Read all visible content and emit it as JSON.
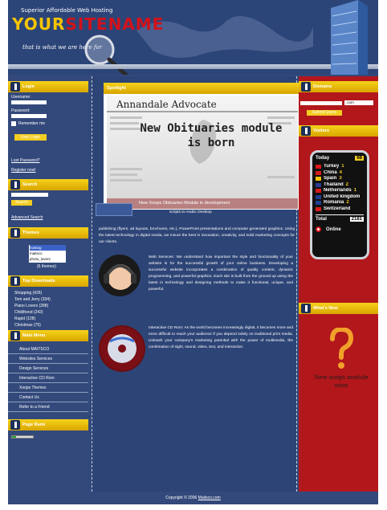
{
  "header": {
    "tagline": "Superior Affordable Web Hosting",
    "logo_part1": "YOUR",
    "logo_part2": "SITENAME",
    "slogan": "that is what we are here for"
  },
  "left": {
    "login": {
      "title": "Login",
      "username_label": "Username:",
      "password_label": "Password:",
      "remember_label": "Remember me",
      "button": "User Login",
      "lost_password": "Lost Password?",
      "register": "Register now!"
    },
    "search": {
      "title": "Search",
      "button": "Search",
      "advanced": "Advanced Search"
    },
    "themes": {
      "title": "Themes",
      "options": [
        "hosting",
        "maitsco",
        "photo_lovers"
      ],
      "count": "(6 themes)"
    },
    "top_downloads": {
      "title": "Top Downloads",
      "items": [
        "Shopping (426)",
        "Tom and Jerry (334)",
        "Piano Lovers (288)",
        "Childhood (242)",
        "Rapid (128)",
        "Christmas (75)"
      ]
    },
    "main_menu": {
      "title": "Main Menu",
      "items": [
        "About MAITSCO",
        "Websites Services",
        "Design Services",
        "Interactive CD Rom",
        "Xoops Themes",
        "Contact Us",
        "Refer to a Friend"
      ]
    },
    "page_rank": {
      "title": "Page Rank"
    }
  },
  "center": {
    "spotlight": {
      "title": "Spotlight",
      "paper_name": "Annandale Advocate",
      "headline": "New Obituaries module is born",
      "caption": "New Xoops Obituaries Module in development",
      "side_text": "scripts to Arabic Desktop"
    },
    "para1": "publishing (flyers, ad layouts, brochures, etc.), PowerPoint presentations and computer generated graphics. Using the latest technology in digital media, we insure the best in innovation, creativity, and solid marketing concepts for our clients.",
    "para2": "Web Services: We understand how important the style and functionality of your website is for the successful growth of your online business. Developing a successful website incorporates a combination of quality content, dynamic programming, and powerful graphics. Each site is built from the ground up using the latest in technology and designing methods to make it functional, unique, and powerful.",
    "para3": "Interactive CD Rom: As the world becomes increasingly digital, it becomes more and more difficult to reach your audience if you depend solely on traditional print media. Unleash your company's marketing potential with the power of multimedia, the combination of sight, sound, video, text, and interaction."
  },
  "right": {
    "domains": {
      "title": "Domains",
      "tld": ".com",
      "button": "Submit Query"
    },
    "visitors": {
      "title": "Visitors",
      "today_label": "Today",
      "today_count": "68",
      "countries": [
        {
          "name": "Turkey",
          "count": "1"
        },
        {
          "name": "China",
          "count": "4"
        },
        {
          "name": "Spain",
          "count": "3"
        },
        {
          "name": "Thailand",
          "count": "2"
        },
        {
          "name": "Netherlands",
          "count": "1"
        },
        {
          "name": "United kingdom",
          "count": ""
        },
        {
          "name": "Romania",
          "count": "2"
        },
        {
          "name": "Switzerland",
          "count": ""
        }
      ],
      "total_label": "Total",
      "total_count": "2181",
      "online_label": "Online"
    },
    "whats_new": {
      "title": "What's New",
      "caption": "New xoops module soon"
    }
  },
  "footer": {
    "text": "Copyright © 2006",
    "link": "Maitsco.com"
  },
  "colors": {
    "header_blue": "#2c4578",
    "body_blue": "#33497b",
    "accent_yellow": "#f2cd22",
    "right_red": "#b2171b"
  }
}
